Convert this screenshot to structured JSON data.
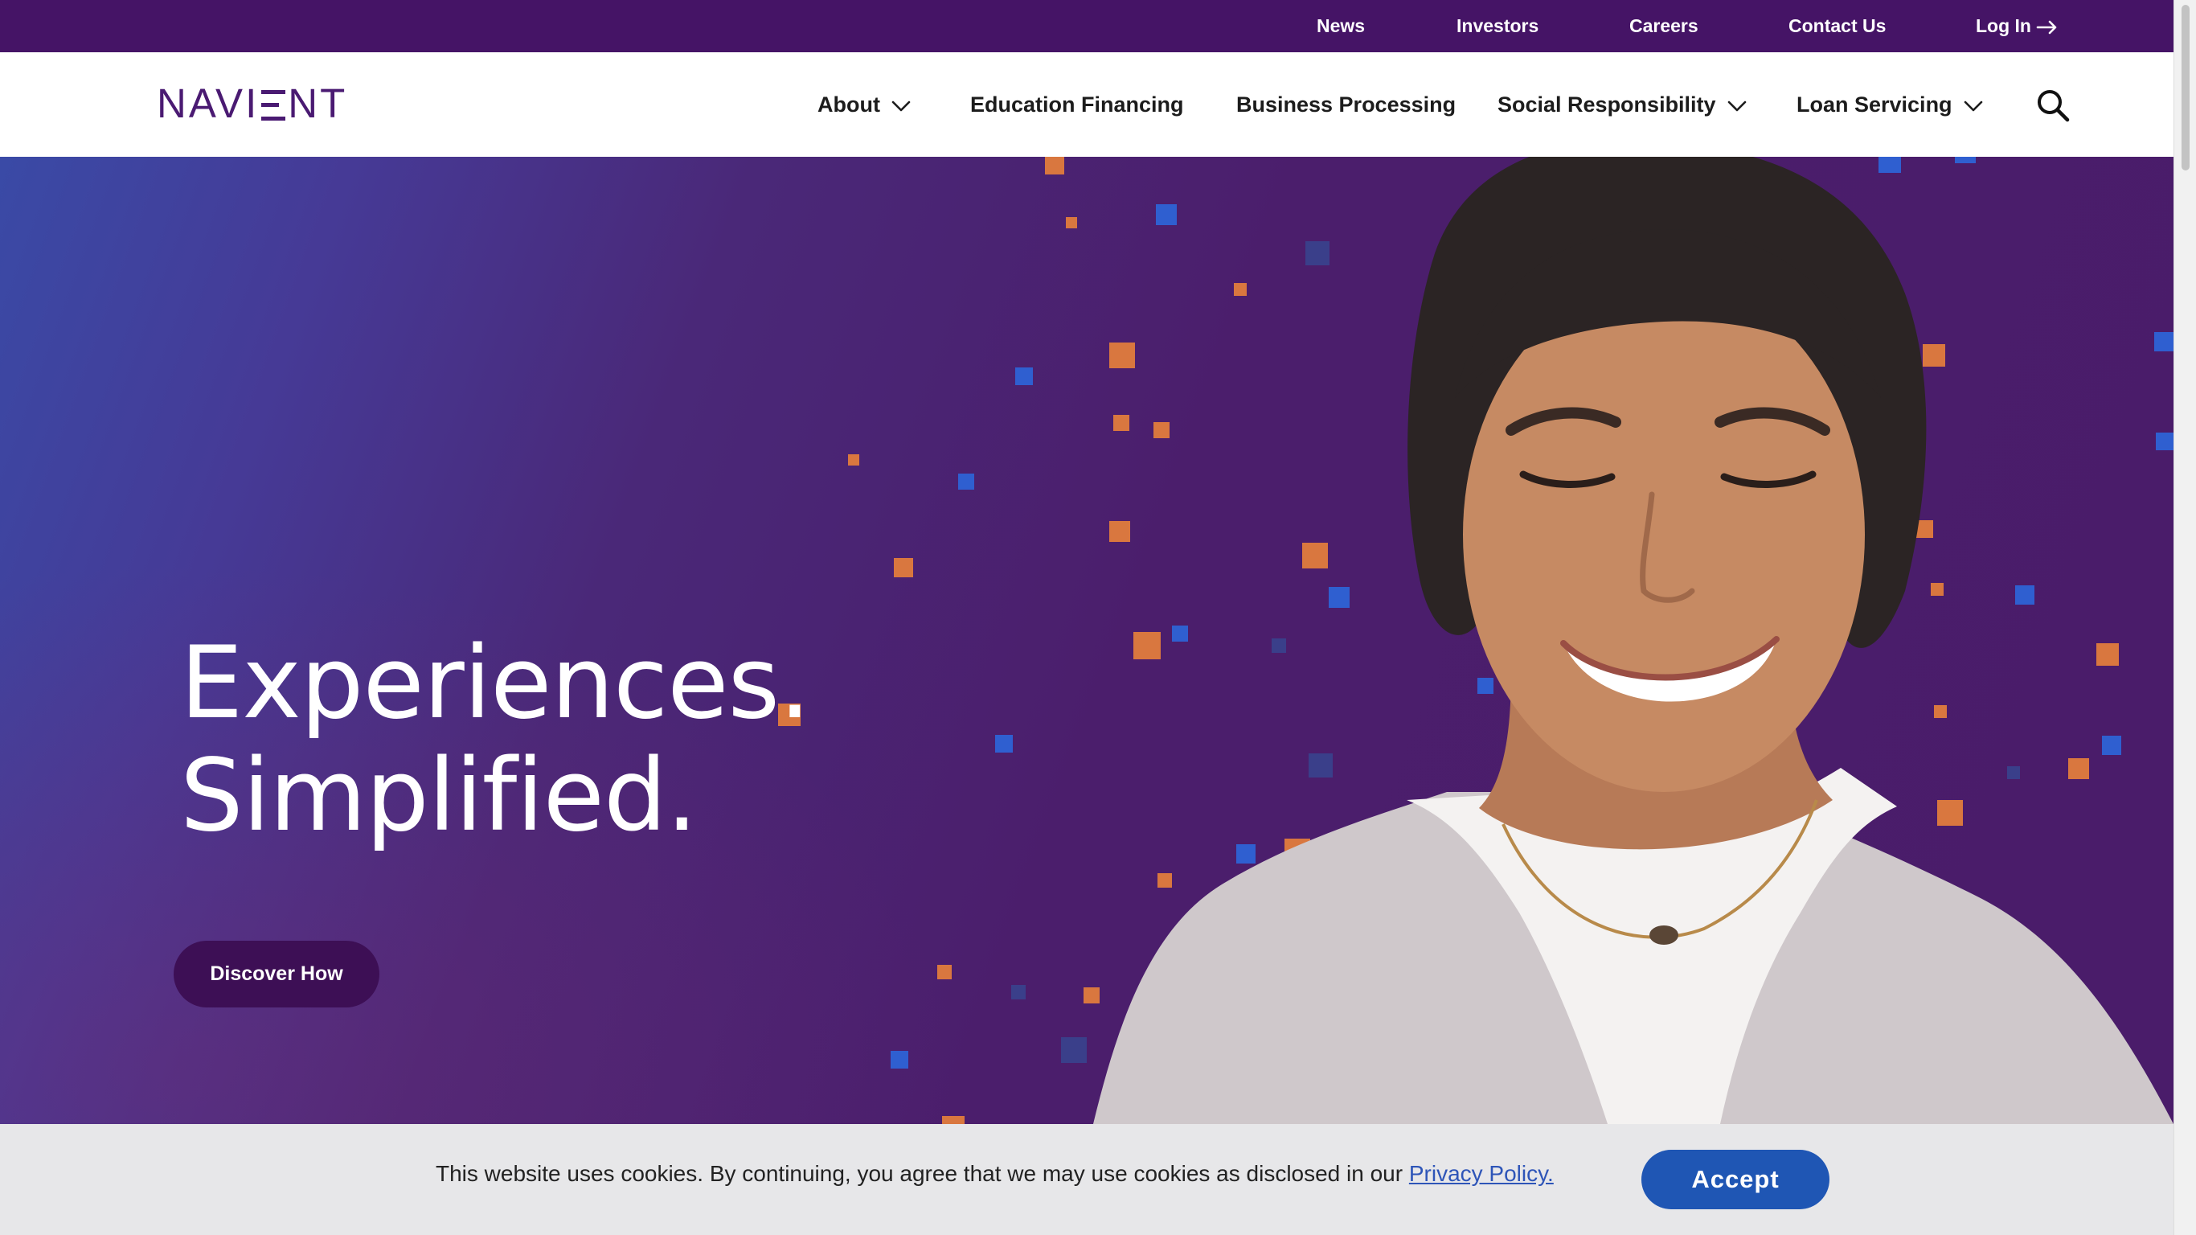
{
  "utility_nav": {
    "items": [
      "News",
      "Investors",
      "Careers",
      "Contact Us"
    ],
    "login_label": "Log In"
  },
  "brand": {
    "logo_text_left": "NAVI",
    "logo_text_right": "NT"
  },
  "main_nav": {
    "about": "About",
    "education_financing": "Education Financing",
    "business_processing": "Business Processing",
    "social_responsibility": "Social Responsibility",
    "loan_servicing": "Loan Servicing"
  },
  "hero": {
    "headline_line1": "Experiences.",
    "headline_line2": "Simplified.",
    "cta_label": "Discover How"
  },
  "cookie_banner": {
    "text": "This website uses cookies. By continuing, you agree that we may use cookies as disclosed in our ",
    "link_label": "Privacy Policy.",
    "accept_label": "Accept"
  },
  "colors": {
    "brand_purple": "#451466",
    "button_blue": "#1f56b4",
    "accent_orange": "#d9773f"
  },
  "icons": [
    "arrow-right-icon",
    "chevron-down-icon",
    "search-icon"
  ]
}
